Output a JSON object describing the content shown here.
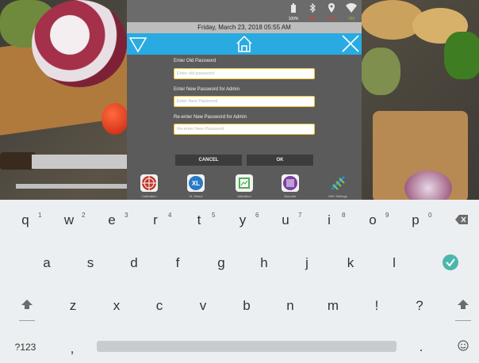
{
  "status": {
    "battery_label": "100%",
    "bluetooth_label": "OFF",
    "gps_label": "OFF",
    "wifi_label": "ON"
  },
  "datetime": "Friday, March 23, 2018 05:55 AM",
  "header": {
    "left_icon": "triangle-down-icon",
    "center_icon": "home-icon",
    "right_icon": "close-icon",
    "color": "#29abe2"
  },
  "form": {
    "old_label": "Enter Old Password",
    "old_placeholder": "Enter old password",
    "new_label": "Enter New Password for Admin",
    "new_placeholder": "Enter New Password",
    "confirm_label": "Re-enter New Password for Admin",
    "confirm_placeholder": "Re-enter New Password",
    "input_border_color": "#f7c531"
  },
  "buttons": {
    "cancel": "CANCEL",
    "ok": "OK"
  },
  "apps": [
    {
      "icon": "target-icon",
      "label": "Calibration"
    },
    {
      "icon": "xl-icon",
      "label": "XL Select"
    },
    {
      "icon": "chart-icon",
      "label": "Utilization"
    },
    {
      "icon": "barcode-icon",
      "label": "Barcode"
    },
    {
      "icon": "wifi-signal-icon",
      "label": "WiFi Settings"
    }
  ],
  "keyboard": {
    "row1": [
      "q",
      "w",
      "e",
      "r",
      "t",
      "y",
      "u",
      "i",
      "o",
      "p"
    ],
    "row1_hints": [
      "1",
      "2",
      "3",
      "4",
      "5",
      "6",
      "7",
      "8",
      "9",
      "0"
    ],
    "row2": [
      "a",
      "s",
      "d",
      "f",
      "g",
      "h",
      "j",
      "k",
      "l"
    ],
    "row3": [
      "z",
      "x",
      "c",
      "v",
      "b",
      "n",
      "m",
      "!",
      "?"
    ],
    "symbols_key": "?123",
    "comma": ",",
    "period": ".",
    "accent_color": "#4db6ac"
  }
}
